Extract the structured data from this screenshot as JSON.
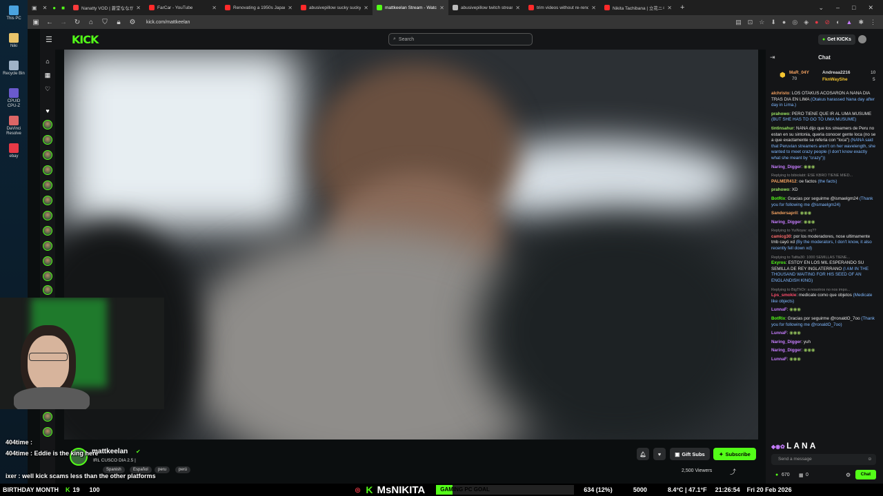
{
  "desktop": {
    "icons": [
      {
        "label": "This PC",
        "color": "#4aa3df"
      },
      {
        "label": "Niki",
        "color": "#e9c46a"
      },
      {
        "label": "Recycle Bin",
        "color": "#9fb3c8"
      },
      {
        "label": "CPUID CPU-Z",
        "color": "#6a5acd"
      },
      {
        "label": "DaVinci Resolve",
        "color": "#d66"
      },
      {
        "label": "ebay",
        "color": "#e63946"
      }
    ]
  },
  "browser": {
    "tabs": [
      {
        "label": "Nanatty VOD | 蒼堂ななが配信",
        "color": "#ff3b3b",
        "active": false
      },
      {
        "label": "FarCar - YouTube",
        "color": "#ff2a2a",
        "active": false
      },
      {
        "label": "Renovating a 1950s Japanese H",
        "color": "#ff2a2a",
        "active": false
      },
      {
        "label": "abusivepillow sucky sucky - Yo",
        "color": "#ff2a2a",
        "active": false
      },
      {
        "label": "mattkeelan Stream - Watch",
        "color": "#53fc18",
        "active": true
      },
      {
        "label": "abusivepillow twitch streamer",
        "color": "#bbbbbb",
        "active": false
      },
      {
        "label": "trim videos without re-renderi",
        "color": "#ff2a2a",
        "active": false
      },
      {
        "label": "Nikita Tachibana | 立花ニキータ",
        "color": "#ff2a2a",
        "active": false
      }
    ],
    "url": "kick.com/mattkeelan"
  },
  "kick": {
    "logo": "KICK",
    "search_placeholder": "Search",
    "get_kicks": "Get KICKs",
    "streamer": "mattkeelan",
    "stream_title": "IRL CUSCO DIA 2.5 |",
    "tags": [
      "Spanish",
      "Español",
      "peru",
      "perú"
    ],
    "gift_subs": "Gift Subs",
    "subscribe": "Subscribe",
    "viewers": "2,500 Viewers"
  },
  "chat": {
    "title": "Chat",
    "leaderboard": [
      {
        "name": "MaR_04Y",
        "value": "70"
      },
      {
        "name": "Andreaa2216",
        "value": "10"
      },
      {
        "name": "FknWayShe",
        "value": "5"
      }
    ],
    "messages": [
      {
        "user": "alchristo",
        "color": "#f4a261",
        "text": "LOS OTAKUS ACOSARON A NANA DIA TRAS DIA EN LIMA",
        "trans": "(Otakus harassed Nana day after day in Lima.)"
      },
      {
        "user": "prahowo",
        "color": "#9be564",
        "text": "PERO TIENE QUE IR AL UMA MUSUME",
        "trans": "(BUT SHE HAS TO GO TO UMA MUSUME)"
      },
      {
        "user": "tintinsahur",
        "color": "#9be564",
        "text": "NANA dijo que los streamers de Peru no estan en su sintonia, queria conocer gente loca (no se a que exactamente se referia con \"loca\")",
        "trans": "(NANA said that Peruvian streamers aren't on her wavelength, she wanted to meet crazy people (I don't know exactly what she meant by \"crazy\"))"
      },
      {
        "user": "Naring_Digger",
        "color": "#c77dff",
        "text": "",
        "trans": ""
      },
      {
        "reply": "Replying to bibiolabt: ESE KBRO TIENE MIED...",
        "user": "PALMER412",
        "color": "#f4a261",
        "text": "oe factos",
        "trans": "(the facts)"
      },
      {
        "user": "prahowo",
        "color": "#9be564",
        "text": "XD",
        "trans": ""
      },
      {
        "user": "BotRix",
        "color": "#53fc18",
        "text": "Gracias por seguirme @ismaelgm24",
        "trans": "(Thank you for following me @ismaelgm24)"
      },
      {
        "user": "Sandersapril",
        "color": "#f4a261",
        "text": "",
        "trans": ""
      },
      {
        "user": "Naring_Digger",
        "color": "#c77dff",
        "text": "",
        "trans": ""
      },
      {
        "reply": "Replying to YuiNoyw: xq??",
        "user": "camicg30",
        "color": "#ff6b6b",
        "text": "por los moderadores, nose ultimamente tmb cayó xd",
        "trans": "(By the moderators, I don't know, it also recently fell down xd)"
      },
      {
        "reply": "Replying to Tafita30: 1000 SEMILLAS TIENE...",
        "user": "Exyros",
        "color": "#53fc18",
        "text": "ESTOY EN LOS MIL ESPERANDO SU SEMILLA DE REY INGLATERRANO",
        "trans": "(I AM IN THE THOUSAND WAITING FOR HIS SEED OF AN ENGLANDISH KING)"
      },
      {
        "reply": "Replying to BigThOr: a nosotros no nos impo...",
        "user": "Lps_smokie",
        "color": "#ff4d6d",
        "text": "medicate como que objetos",
        "trans": "(Medicate like objects)"
      },
      {
        "user": "LunnaF",
        "color": "#c77dff",
        "text": "",
        "trans": ""
      },
      {
        "user": "BotRix",
        "color": "#53fc18",
        "text": "Gracias por seguirme @ronaldO_7oo",
        "trans": "(Thank you for following me @ronaldO_7oo)"
      },
      {
        "user": "LunnaF",
        "color": "#c77dff",
        "text": "",
        "trans": ""
      },
      {
        "user": "Naring_Digger",
        "color": "#c77dff",
        "text": "yuh",
        "trans": ""
      },
      {
        "user": "Naring_Digger",
        "color": "#c77dff",
        "text": "",
        "trans": ""
      },
      {
        "user": "LunnaF",
        "color": "#c77dff",
        "text": "",
        "trans": ""
      }
    ],
    "emote_text": "LANA",
    "input_placeholder": "Send a message",
    "kicks_count": "670",
    "zero_count": "0",
    "chat_button": "Chat"
  },
  "overlay": {
    "lines": [
      {
        "user": "404time",
        "text": ""
      },
      {
        "user": "404time",
        "text": "Eddie is the king here"
      },
      {
        "user": "ixer",
        "text": "well kick scams less than the other platforms"
      }
    ]
  },
  "ticker": {
    "left": "BIRTHDAY MONTH",
    "num1": "19",
    "num2": "100",
    "center": "MsNIKITA",
    "goal_label": "GAMING PC GOAL",
    "goal_value": "634 (12%)",
    "goal_target": "5000",
    "temp": "8.4°C | 47.1°F",
    "time": "21:26:54",
    "date": "Fri 20 Feb 2026"
  }
}
